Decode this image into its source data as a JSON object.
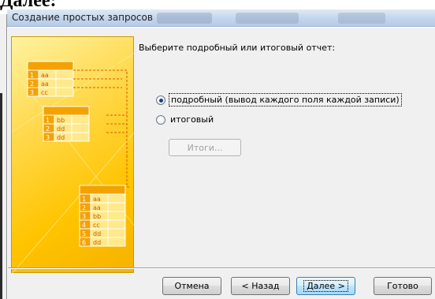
{
  "doc": {
    "heading": "Далее:"
  },
  "window": {
    "title": "Создание простых запросов"
  },
  "illustration": {
    "table_top": [
      [
        "1",
        "aa"
      ],
      [
        "2",
        "aa"
      ],
      [
        "3",
        "cc"
      ]
    ],
    "table_middle": [
      [
        "1",
        "bb"
      ],
      [
        "2",
        "dd"
      ],
      [
        "3",
        "dd"
      ]
    ],
    "table_bottom": [
      [
        "1",
        "aa"
      ],
      [
        "2",
        "aa"
      ],
      [
        "3",
        "bb"
      ],
      [
        "4",
        "cc"
      ],
      [
        "5",
        "dd"
      ],
      [
        "6",
        "dd"
      ]
    ]
  },
  "wizard": {
    "prompt": "Выберите подробный или итоговый отчет:",
    "option_detail": "подробный (вывод каждого поля каждой записи)",
    "option_summary": "итоговый",
    "selected_option": "detail",
    "summary_options_button": "Итоги..."
  },
  "buttons": {
    "cancel": "Отмена",
    "back": "< Назад",
    "next": "Далее >",
    "finish": "Готово"
  },
  "colors": {
    "art_yellow": "#ffc400",
    "art_cell": "#ffe98a",
    "art_header": "#f3a200",
    "art_dash": "#d95a00",
    "default_button": "#bee6fd"
  }
}
